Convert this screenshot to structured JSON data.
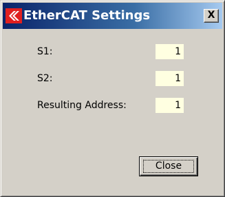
{
  "window": {
    "title": "EtherCAT Settings",
    "close_glyph": "X",
    "logo_icon": "ethercat-logo-icon"
  },
  "fields": [
    {
      "label": "S1:",
      "value": "1"
    },
    {
      "label": "S2:",
      "value": "1"
    },
    {
      "label": "Resulting Address:",
      "value": "1"
    }
  ],
  "buttons": {
    "close_label": "Close"
  },
  "colors": {
    "title_start": "#0a246a",
    "title_end": "#a6caf0",
    "dialog_bg": "#d4d0c8",
    "value_bg": "#ffffe1",
    "logo_red": "#e02020"
  }
}
